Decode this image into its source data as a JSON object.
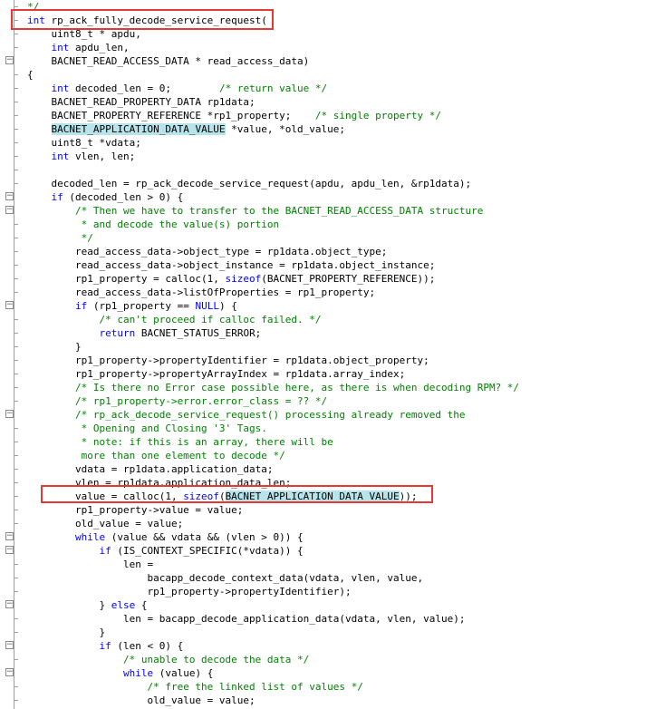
{
  "colors": {
    "keyword": "#0000ff",
    "comment": "#008000",
    "highlight": "#b7e3ea",
    "annotation_box": "#e53935"
  },
  "code_lines": [
    {
      "text": "*/",
      "fold": null
    },
    {
      "text": "int rp_ack_fully_decode_service_request(",
      "fold": null
    },
    {
      "text": "    uint8_t * apdu,",
      "fold": null
    },
    {
      "text": "    int apdu_len,",
      "fold": null
    },
    {
      "text": "    BACNET_READ_ACCESS_DATA * read_access_data)",
      "fold": "minus"
    },
    {
      "text": "{",
      "fold": null
    },
    {
      "text": "    int decoded_len = 0;        /* return value */",
      "fold": null
    },
    {
      "text": "    BACNET_READ_PROPERTY_DATA rp1data;",
      "fold": null
    },
    {
      "text": "    BACNET_PROPERTY_REFERENCE *rp1_property;    /* single property */",
      "fold": null
    },
    {
      "text": "    BACNET_APPLICATION_DATA_VALUE *value, *old_value;",
      "fold": null
    },
    {
      "text": "    uint8_t *vdata;",
      "fold": null
    },
    {
      "text": "    int vlen, len;",
      "fold": null
    },
    {
      "text": "",
      "fold": null
    },
    {
      "text": "    decoded_len = rp_ack_decode_service_request(apdu, apdu_len, &rp1data);",
      "fold": null
    },
    {
      "text": "    if (decoded_len > 0) {",
      "fold": "minus"
    },
    {
      "text": "        /* Then we have to transfer to the BACNET_READ_ACCESS_DATA structure",
      "fold": "minus"
    },
    {
      "text": "         * and decode the value(s) portion",
      "fold": null
    },
    {
      "text": "         */",
      "fold": null
    },
    {
      "text": "        read_access_data->object_type = rp1data.object_type;",
      "fold": null
    },
    {
      "text": "        read_access_data->object_instance = rp1data.object_instance;",
      "fold": null
    },
    {
      "text": "        rp1_property = calloc(1, sizeof(BACNET_PROPERTY_REFERENCE));",
      "fold": null
    },
    {
      "text": "        read_access_data->listOfProperties = rp1_property;",
      "fold": null
    },
    {
      "text": "        if (rp1_property == NULL) {",
      "fold": "minus"
    },
    {
      "text": "            /* can't proceed if calloc failed. */",
      "fold": null
    },
    {
      "text": "            return BACNET_STATUS_ERROR;",
      "fold": null
    },
    {
      "text": "        }",
      "fold": null
    },
    {
      "text": "        rp1_property->propertyIdentifier = rp1data.object_property;",
      "fold": null
    },
    {
      "text": "        rp1_property->propertyArrayIndex = rp1data.array_index;",
      "fold": null
    },
    {
      "text": "        /* Is there no Error case possible here, as there is when decoding RPM? */",
      "fold": null
    },
    {
      "text": "        /* rp1_property->error.error_class = ?? */",
      "fold": null
    },
    {
      "text": "        /* rp_ack_decode_service_request() processing already removed the",
      "fold": "minus"
    },
    {
      "text": "         * Opening and Closing '3' Tags.",
      "fold": null
    },
    {
      "text": "         * note: if this is an array, there will be",
      "fold": null
    },
    {
      "text": "         more than one element to decode */",
      "fold": null
    },
    {
      "text": "        vdata = rp1data.application_data;",
      "fold": null
    },
    {
      "text": "        vlen = rp1data.application_data_len;",
      "fold": null
    },
    {
      "text": "        value = calloc(1, sizeof(BACNET_APPLICATION_DATA_VALUE));",
      "fold": null
    },
    {
      "text": "        rp1_property->value = value;",
      "fold": null
    },
    {
      "text": "        old_value = value;",
      "fold": null
    },
    {
      "text": "        while (value && vdata && (vlen > 0)) {",
      "fold": "minus"
    },
    {
      "text": "            if (IS_CONTEXT_SPECIFIC(*vdata)) {",
      "fold": "minus"
    },
    {
      "text": "                len =",
      "fold": null
    },
    {
      "text": "                    bacapp_decode_context_data(vdata, vlen, value,",
      "fold": null
    },
    {
      "text": "                    rp1_property->propertyIdentifier);",
      "fold": null
    },
    {
      "text": "            } else {",
      "fold": "minus"
    },
    {
      "text": "                len = bacapp_decode_application_data(vdata, vlen, value);",
      "fold": null
    },
    {
      "text": "            }",
      "fold": null
    },
    {
      "text": "            if (len < 0) {",
      "fold": "minus"
    },
    {
      "text": "                /* unable to decode the data */",
      "fold": null
    },
    {
      "text": "                while (value) {",
      "fold": "minus"
    },
    {
      "text": "                    /* free the linked list of values */",
      "fold": null
    },
    {
      "text": "                    old_value = value;",
      "fold": null
    }
  ]
}
